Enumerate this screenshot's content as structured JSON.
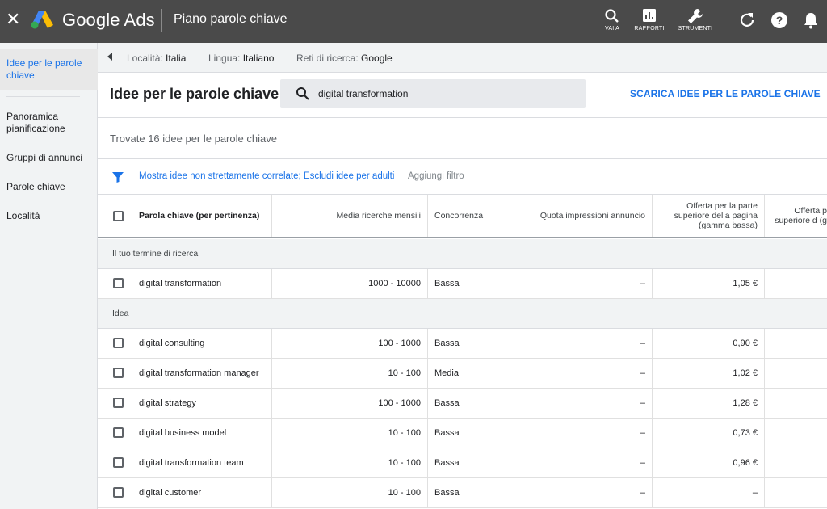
{
  "topbar": {
    "brand": "Google Ads",
    "page_title": "Piano parole chiave",
    "tools": [
      {
        "label": "VAI A",
        "icon": "search-icon"
      },
      {
        "label": "RAPPORTI",
        "icon": "reports-icon"
      },
      {
        "label": "STRUMENTI",
        "icon": "wrench-icon"
      }
    ],
    "icons": [
      "close-icon",
      "refresh-icon",
      "help-icon",
      "bell-icon"
    ]
  },
  "sidebar": {
    "items": [
      {
        "label": "Idee per le parole chiave",
        "active": true
      },
      {
        "label": "Panoramica pianificazione",
        "active": false
      },
      {
        "label": "Gruppi di annunci",
        "active": false
      },
      {
        "label": "Parole chiave",
        "active": false
      },
      {
        "label": "Località",
        "active": false
      }
    ]
  },
  "filterbar": {
    "location_label": "Località:",
    "location_value": "Italia",
    "language_label": "Lingua:",
    "language_value": "Italiano",
    "network_label": "Reti di ricerca:",
    "network_value": "Google"
  },
  "main": {
    "title": "Idee per le parole chiave",
    "search_value": "digital transformation",
    "download_label": "SCARICA IDEE PER LE PAROLE CHIAVE",
    "count_text": "Trovate 16 idee per le parole chiave",
    "filter_link": "Mostra idee non strettamente correlate; Escludi idee per adulti",
    "filter_add": "Aggiungi filtro"
  },
  "table": {
    "headers": {
      "keyword": "Parola chiave (per pertinenza)",
      "volume": "Media ricerche mensili",
      "competition": "Concorrenza",
      "impression_share": "Quota impressioni annuncio",
      "bid_low": "Offerta per la parte superiore della pagina (gamma bassa)",
      "bid_high": "Offerta p superiore d (g"
    },
    "group_search_term": "Il tuo termine di ricerca",
    "search_term_row": {
      "keyword": "digital transformation",
      "volume": "1000 - 10000",
      "competition": "Bassa",
      "impression_share": "–",
      "bid_low": "1,05 €"
    },
    "group_ideas": "Idea",
    "rows": [
      {
        "keyword": "digital consulting",
        "volume": "100 - 1000",
        "competition": "Bassa",
        "impression_share": "–",
        "bid_low": "0,90 €"
      },
      {
        "keyword": "digital transformation manager",
        "volume": "10 - 100",
        "competition": "Media",
        "impression_share": "–",
        "bid_low": "1,02 €"
      },
      {
        "keyword": "digital strategy",
        "volume": "100 - 1000",
        "competition": "Bassa",
        "impression_share": "–",
        "bid_low": "1,28 €"
      },
      {
        "keyword": "digital business model",
        "volume": "10 - 100",
        "competition": "Bassa",
        "impression_share": "–",
        "bid_low": "0,73 €"
      },
      {
        "keyword": "digital transformation team",
        "volume": "10 - 100",
        "competition": "Bassa",
        "impression_share": "–",
        "bid_low": "0,96 €"
      },
      {
        "keyword": "digital customer",
        "volume": "10 - 100",
        "competition": "Bassa",
        "impression_share": "–",
        "bid_low": "–"
      }
    ]
  },
  "colors": {
    "topbar": "#4a4a4a",
    "accent": "#1a73e8",
    "sidebar_bg": "#f1f3f4"
  }
}
